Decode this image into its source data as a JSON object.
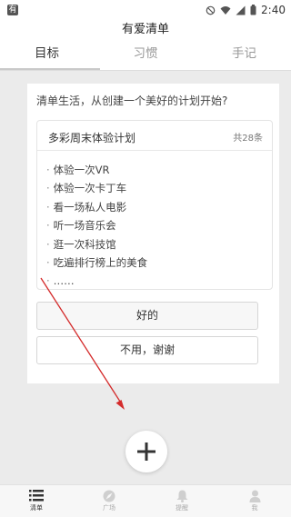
{
  "status": {
    "brand": "有",
    "time": "2:40"
  },
  "header": {
    "title": "有爱清单"
  },
  "tabs": [
    {
      "label": "目标",
      "active": true
    },
    {
      "label": "习惯",
      "active": false
    },
    {
      "label": "手记",
      "active": false
    }
  ],
  "card": {
    "question": "清单生活，从创建一个美好的计划开始?",
    "plan": {
      "title": "多彩周末体验计划",
      "count": "共28条",
      "items": [
        "体验一次VR",
        "体验一次卡丁车",
        "看一场私人电影",
        "听一场音乐会",
        "逛一次科技馆",
        "吃遍排行榜上的美食",
        "……"
      ]
    },
    "ok_label": "好的",
    "no_label": "不用，谢谢"
  },
  "bottom_nav": [
    {
      "label": "清单",
      "icon": "list-icon",
      "active": true
    },
    {
      "label": "广场",
      "icon": "compass-icon",
      "active": false
    },
    {
      "label": "提醒",
      "icon": "bell-icon",
      "active": false
    },
    {
      "label": "我",
      "icon": "person-icon",
      "active": false
    }
  ],
  "colors": {
    "arrow": "#d42b2b",
    "background": "#ebebeb"
  }
}
